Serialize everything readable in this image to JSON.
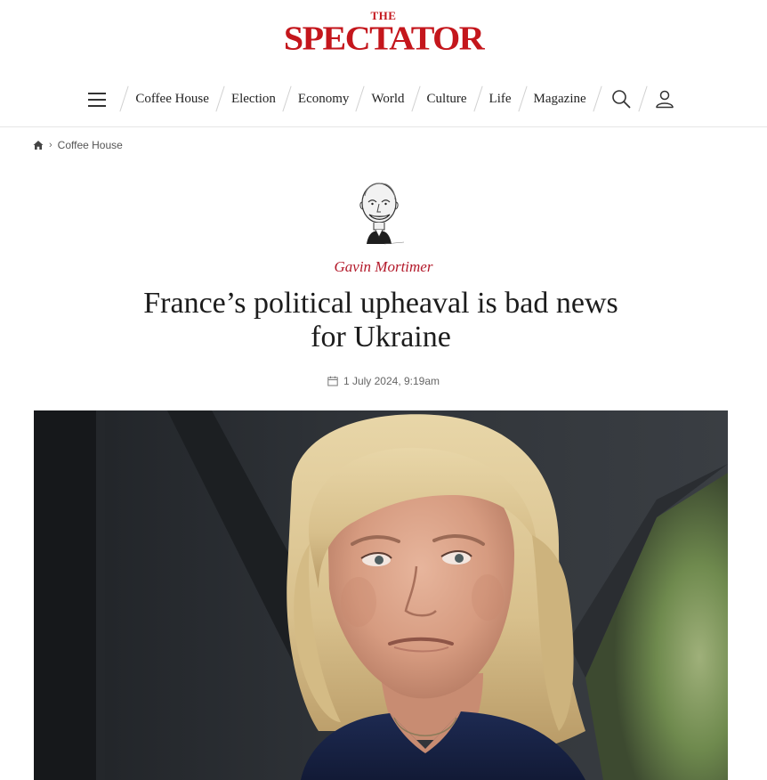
{
  "brand": {
    "small": "THE",
    "name": "SPECTATOR",
    "color": "#c4161c"
  },
  "nav": {
    "items": [
      {
        "label": "Coffee House"
      },
      {
        "label": "Election"
      },
      {
        "label": "Economy"
      },
      {
        "label": "World"
      },
      {
        "label": "Culture"
      },
      {
        "label": "Life"
      },
      {
        "label": "Magazine"
      }
    ],
    "icons": [
      "menu-icon",
      "search-icon",
      "user-icon"
    ]
  },
  "breadcrumb": {
    "home_icon": "home-icon",
    "separator_icon": "chevron-right-icon",
    "current": "Coffee House"
  },
  "article": {
    "author": "Gavin Mortimer",
    "headline": "France’s political upheaval is bad news for Ukraine",
    "date": "1 July 2024, 9:19am",
    "author_color": "#b3192a"
  }
}
